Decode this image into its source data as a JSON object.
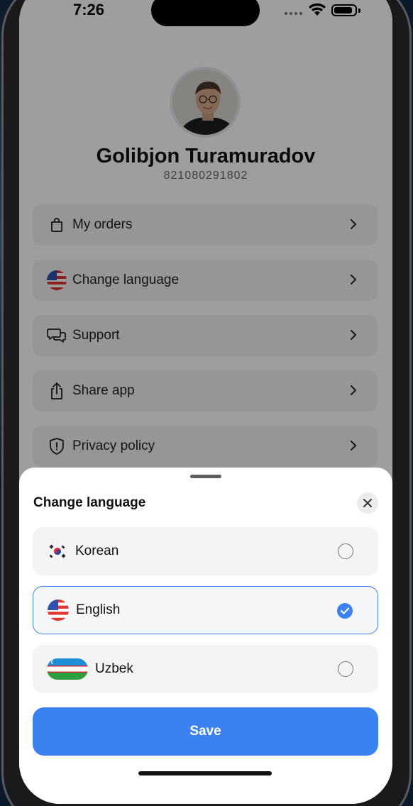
{
  "status_bar": {
    "time": "7:26"
  },
  "profile": {
    "name": "Golibjon Turamuradov",
    "id": "821080291802"
  },
  "menu": [
    {
      "label": "My orders",
      "icon": "bag-icon"
    },
    {
      "label": "Change language",
      "icon": "us-flag-icon"
    },
    {
      "label": "Support",
      "icon": "chat-bubbles-icon"
    },
    {
      "label": "Share app",
      "icon": "share-icon"
    },
    {
      "label": "Privacy policy",
      "icon": "shield-icon"
    }
  ],
  "sheet": {
    "title": "Change language",
    "options": [
      {
        "label": "Korean",
        "flag": "korea-flag-icon",
        "selected": false
      },
      {
        "label": "English",
        "flag": "us-flag-icon",
        "selected": true
      },
      {
        "label": "Uzbek",
        "flag": "uzbekistan-flag-icon",
        "selected": false
      }
    ],
    "save_label": "Save"
  },
  "colors": {
    "accent": "#3b82f0",
    "card_bg": "#f2f2f2",
    "overlay": "rgba(0,0,0,0.38)"
  }
}
